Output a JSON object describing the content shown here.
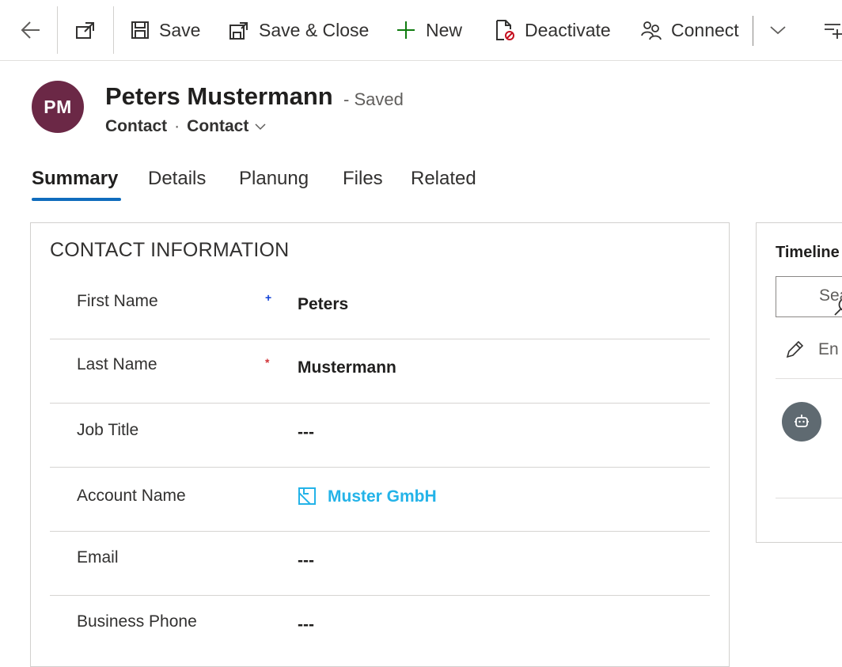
{
  "commandbar": {
    "back_icon": "back-arrow-icon",
    "popout_icon": "open-new-window-icon",
    "save_label": "Save",
    "save_close_label": "Save & Close",
    "new_label": "New",
    "deactivate_label": "Deactivate",
    "connect_label": "Connect",
    "more_icon": "chevron-down-icon",
    "overflow_icon": "add-to-list-icon"
  },
  "record": {
    "initials": "PM",
    "avatar_color": "#6b2846",
    "name": "Peters Mustermann",
    "status": "- Saved",
    "entity": "Contact",
    "separator": "·",
    "form_name": "Contact"
  },
  "tabs": [
    {
      "label": "Summary",
      "active": true
    },
    {
      "label": "Details"
    },
    {
      "label": "Planung"
    },
    {
      "label": "Files"
    },
    {
      "label": "Related"
    }
  ],
  "contact_info": {
    "title": "CONTACT INFORMATION",
    "fields": [
      {
        "label": "First Name",
        "required": "+",
        "required_color": "#0f3fd6",
        "value": "Peters"
      },
      {
        "label": "Last Name",
        "required": "*",
        "required_color": "#d13438",
        "value": "Mustermann"
      },
      {
        "label": "Job Title",
        "value": "---"
      },
      {
        "label": "Account Name",
        "value": "Muster GmbH",
        "link_color": "#24b3e8"
      },
      {
        "label": "Email",
        "value": "---"
      },
      {
        "label": "Business Phone",
        "value": "---"
      }
    ]
  },
  "timeline": {
    "title": "Timeline",
    "search_placeholder": "Sea",
    "note_placeholder": "En",
    "bot_icon": "bot-icon"
  },
  "colors": {
    "accent": "#0f6cbd",
    "link": "#24b3e8",
    "new_icon": "#107c10"
  }
}
